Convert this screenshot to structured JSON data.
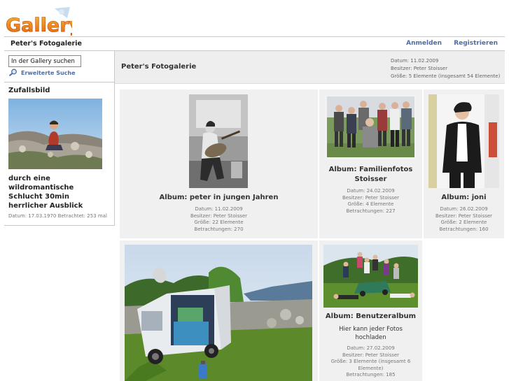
{
  "logo": {
    "text": "Gallery"
  },
  "header": {
    "site_title": "Peter's Fotogalerie",
    "login": "Anmelden",
    "register": "Registrieren"
  },
  "sidebar": {
    "search": {
      "value": "In der Gallery suchen"
    },
    "advanced_search": "Erweiterte Suche",
    "random": {
      "title": "Zufallsbild",
      "caption": "durch eine wildromantische Schlucht 30min herrlicher Ausblick",
      "meta": "Datum: 17.03.1970 Betrachtet: 253 mal"
    }
  },
  "main": {
    "title": "Peter's Fotogalerie",
    "info": {
      "date": "Datum: 11.02.2009",
      "owner": "Besitzer: Peter Stoisser",
      "size": "Größe: 5 Elemente (insgesamt 54 Elemente)"
    }
  },
  "albums": [
    {
      "title": "Album: peter in jungen Jahren",
      "meta": [
        "Datum: 11.02.2009",
        "Besitzer: Peter Stoisser",
        "Größe: 22 Elemente",
        "Betrachtungen: 270"
      ]
    },
    {
      "title": "Album: Familienfotos Stoisser",
      "meta": [
        "Datum: 24.02.2009",
        "Besitzer: Peter Stoisser",
        "Größe: 4 Elemente",
        "Betrachtungen: 227"
      ]
    },
    {
      "title": "Album: joni",
      "meta": [
        "Datum: 26.02.2009",
        "Besitzer: Peter Stoisser",
        "Größe: 2 Elemente",
        "Betrachtungen: 160"
      ]
    },
    {
      "title": "",
      "meta": []
    },
    {
      "title": "Album: Benutzeralbum",
      "description": "Hier kann jeder Fotos hochladen",
      "meta": [
        "Datum: 27.02.2009",
        "Besitzer: Peter Stoisser",
        "Größe: 3 Elemente (insgesamt 6 Elemente)",
        "Betrachtungen: 185"
      ]
    }
  ]
}
